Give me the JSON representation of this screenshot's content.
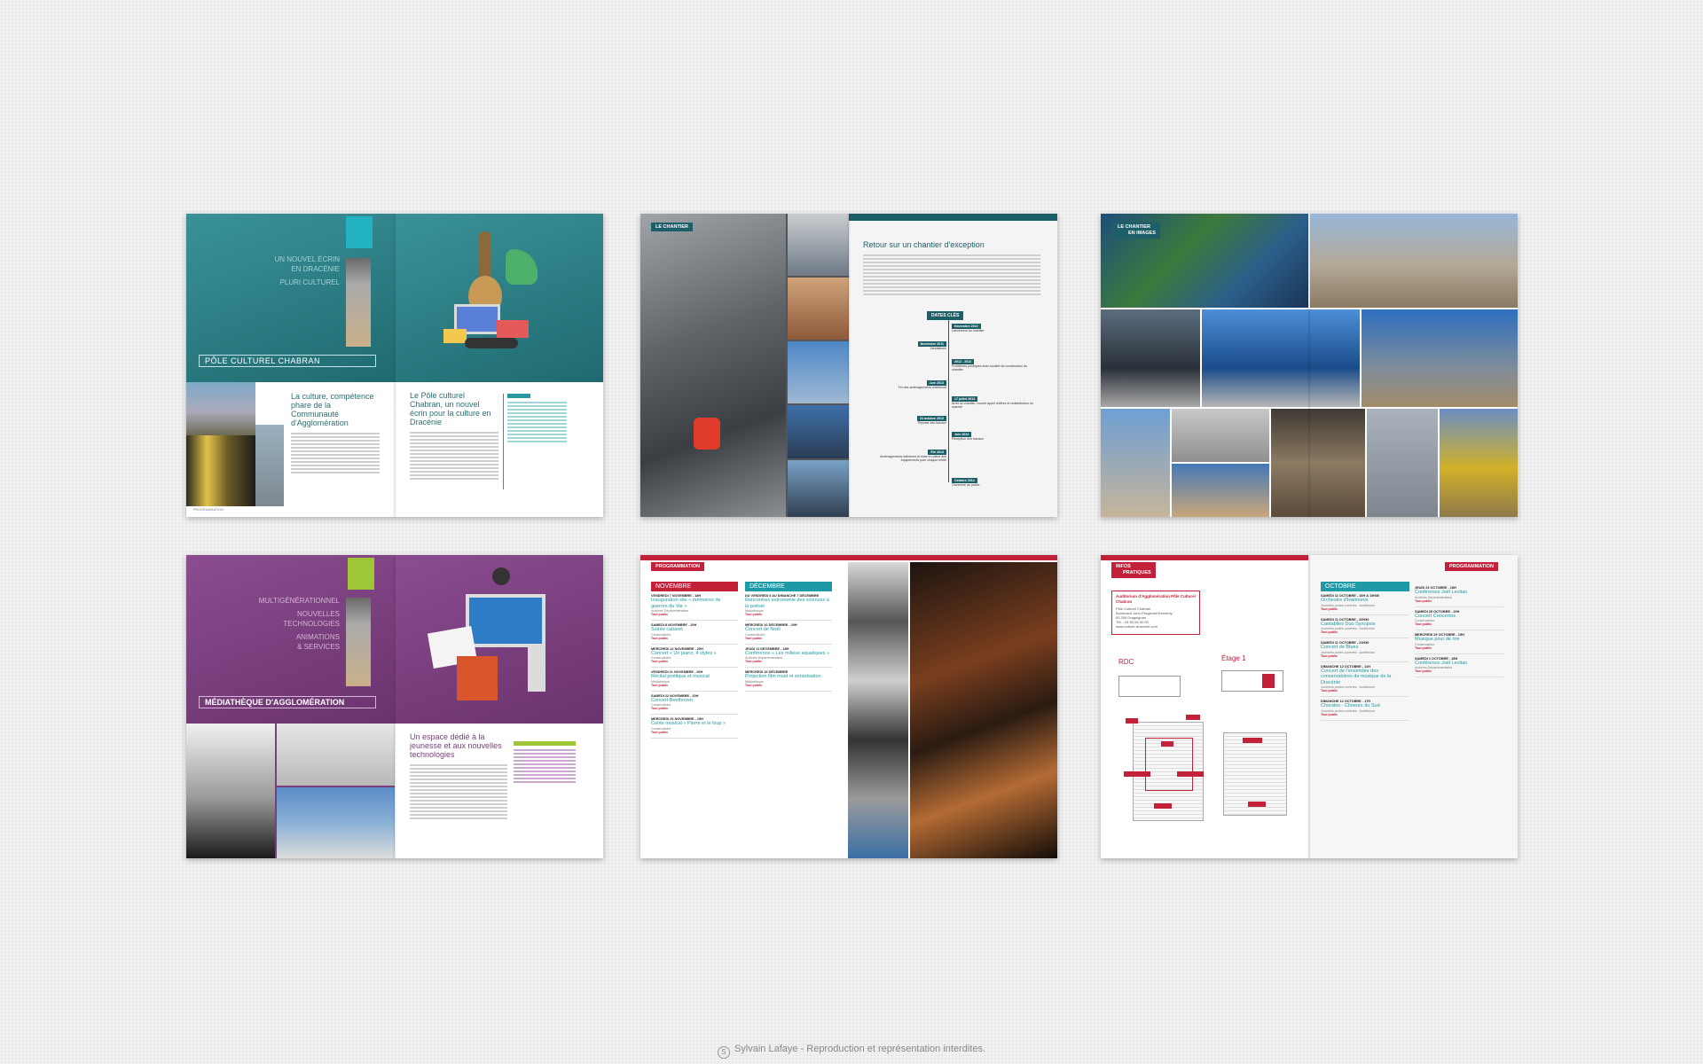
{
  "colors": {
    "teal": "#2a7c82",
    "darkteal": "#17545c",
    "purple": "#7a3f7d",
    "red": "#c3213a",
    "cyan": "#1d9aa5"
  },
  "spread1": {
    "hero": [
      "UN NOUVEL ÉCRIN",
      "EN DRACÉNIE",
      "PLURI CULTUREL"
    ],
    "brand": "PÔLE CULTUREL CHABRAN",
    "title_left": "La culture, compétence phare de la Communauté d'Agglomération",
    "title_right": "Le Pôle culturel Chabran, un nouvel écrin pour la culture en Dracénie",
    "foot": "PROGRAMMATION"
  },
  "spread2": {
    "tag": "LE CHANTIER",
    "title": "Retour sur un chantier d'exception",
    "key_dates_label": "DATES CLÉS",
    "timeline": [
      {
        "date": "Novembre 2010",
        "text": "Lancement du chantier"
      },
      {
        "date": "Novembre 2011",
        "text": "Vandalisme"
      },
      {
        "date": "2012 - 2013",
        "text": "Problèmes juridiques avec société de construction du chantier"
      },
      {
        "date": "Juin 2013",
        "text": "Fin des aménagements extérieurs"
      },
      {
        "date": "17 juillet 2013",
        "text": "Arrêt du chantier, nouvel appel d'offres et redistribution du marché"
      },
      {
        "date": "24 octobre 2013",
        "text": "Reprise des travaux"
      },
      {
        "date": "Juin 2014",
        "text": "Réception des travaux"
      },
      {
        "date": "Été 2014",
        "text": "Aménagements intérieurs et mise en place des équipements pour chaque entité"
      },
      {
        "date": "Octobre 2014",
        "text": "Ouverture au public"
      }
    ]
  },
  "spread3": {
    "tag_line1": "LE CHANTIER",
    "tag_line2": "EN IMAGES"
  },
  "spread4": {
    "hero": [
      "MULTIGÉNÉRATIONNEL",
      "NOUVELLES",
      "TECHNOLOGIES",
      "ANIMATIONS",
      "& SERVICES"
    ],
    "brand": "MÉDIATHÈQUE D'AGGLOMÉRATION",
    "title": "Un espace dédié à la jeunesse et aux nouvelles technologies"
  },
  "spread5": {
    "tag": "PROGRAMMATION",
    "month_left": "NOVEMBRE",
    "month_right": "DÉCEMBRE",
    "events_left": [
      {
        "date": "VENDREDI 7 NOVEMBRE - 18H",
        "title": "Inauguration site « mémoires de guerres du Var »",
        "place": "Archives Départementales",
        "tp": "Tout public"
      },
      {
        "date": "SAMEDI 8 NOVEMBRE - 20H",
        "title": "Soirée cabaret",
        "place": "Conservatoire",
        "tp": "Tout public"
      },
      {
        "date": "MERCREDI 12 NOVEMBRE - 20H",
        "title": "Concert « Un piano, 4 styles »",
        "place": "Conservatoire",
        "tp": "Tout public"
      },
      {
        "date": "VENDREDI 21 NOVEMBRE - 20H",
        "title": "Récital poétique et musical",
        "place": "Médiathèque",
        "tp": "Tout public"
      },
      {
        "date": "SAMEDI 22 NOVEMBRE - 20H",
        "title": "Concert Beethoven",
        "place": "Conservatoire",
        "tp": "Tout public"
      },
      {
        "date": "MERCREDI 26 NOVEMBRE - 15H",
        "title": "Conte musical « Pierre et le loup »",
        "place": "Conservatoire",
        "tp": "Tout public"
      }
    ],
    "events_right": [
      {
        "date": "DU VENDREDI 5 AU DIMANCHE 7 DÉCEMBRE",
        "title": "Rencontres astronomie des sciences à la poésie",
        "place": "Médiathèque",
        "tp": "Tout public"
      },
      {
        "date": "MERCREDI 10 DÉCEMBRE - 20H",
        "title": "Concert de Noël",
        "place": "Conservatoire",
        "tp": "Tout public"
      },
      {
        "date": "JEUDI 11 DÉCEMBRE - 18H",
        "title": "Conférence « Les milieux aquatiques »",
        "place": "Archives Départementales",
        "tp": "Tout public"
      },
      {
        "date": "MERCREDI 19 DÉCEMBRE",
        "title": "Projection film muet et sonorisation",
        "place": "Médiathèque",
        "tp": "Tout public"
      }
    ]
  },
  "spread6": {
    "tag_l1": "INFOS",
    "tag_l2": "PRATIQUES",
    "tag_right": "PROGRAMMATION",
    "addr_title": "Auditorium d'Agglomération Pôle Culturel Chabran",
    "addr_lines": [
      "Pôle Culturel Chabran",
      "Boulevard John-Fitzgerald Kennedy",
      "83 300 Draguignan",
      "Tél. : 04 83 08 30 00",
      "www.culture-dracenie.com"
    ],
    "rdc": "RDC",
    "etage": "Étage 1",
    "month": "OCTOBRE",
    "events_mid": [
      {
        "date": "SAMEDI 11 OCTOBRE - 16H & 19H30",
        "title": "Orchestre d'Harmonie",
        "place": "Journées portes ouvertes · Auditorium",
        "tp": "Tout public"
      },
      {
        "date": "SAMEDI 11 OCTOBRE - 20H30",
        "title": "Cantabiles Duo Synopsis",
        "place": "Journées portes ouvertes · Auditorium",
        "tp": "Tout public"
      },
      {
        "date": "SAMEDI 11 OCTOBRE - 21H30",
        "title": "Concert de Blues",
        "place": "Journées portes ouvertes · Auditorium",
        "tp": "Tout public"
      },
      {
        "date": "DIMANCHE 12 OCTOBRE - 11H",
        "title": "Concert de l'ensemble des conservatoires de musique de la Dracénie",
        "place": "Journées portes ouvertes · Auditorium",
        "tp": "Tout public"
      },
      {
        "date": "DIMANCHE 12 OCTOBRE - 17H",
        "title": "Chorales - Choeurs du Sud",
        "place": "Journées portes ouvertes · Auditorium",
        "tp": "Tout public"
      }
    ],
    "events_right": [
      {
        "date": "JEUDI 23 OCTOBRE - 18H",
        "title": "Conférence Joël Levitan",
        "place": "Archives Départementales",
        "tp": "Tout public"
      },
      {
        "date": "SAMEDI 25 OCTOBRE - 20H",
        "title": "Concert Concertos",
        "place": "Conservatoire",
        "tp": "Tout public"
      },
      {
        "date": "MERCREDI 29 OCTOBRE - 15H",
        "title": "Musique pour de rire",
        "place": "Conservatoire",
        "tp": "Tout public"
      },
      {
        "date": "SAMEDI 1 OCTOBRE - 18H",
        "title": "Conférence Joël Levitan",
        "place": "Archives Départementales",
        "tp": "Tout public"
      }
    ]
  },
  "footer": {
    "text": "Sylvain Lafaye - Reproduction et représentation interdites."
  }
}
